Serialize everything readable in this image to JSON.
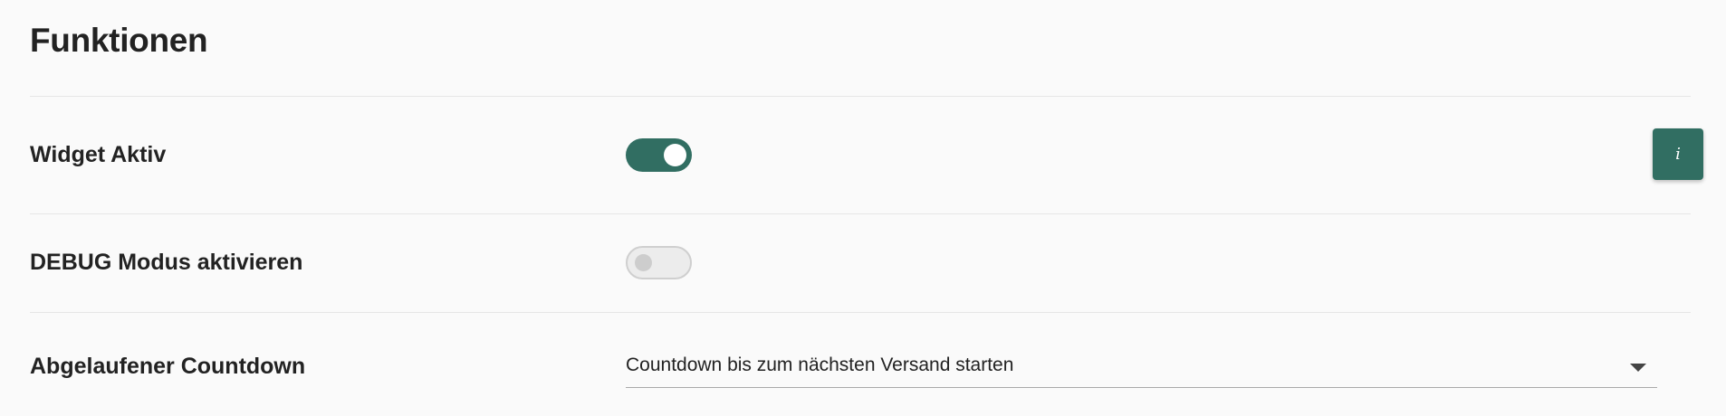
{
  "section": {
    "title": "Funktionen"
  },
  "settings": [
    {
      "label": "Widget Aktiv",
      "control": "toggle",
      "state": "on"
    },
    {
      "label": "DEBUG Modus aktivieren",
      "control": "toggle",
      "state": "off"
    },
    {
      "label": "Abgelaufener Countdown",
      "control": "select",
      "value": "Countdown bis zum nächsten Versand starten"
    }
  ],
  "info_button": {
    "label": "i",
    "icon": "info-icon"
  },
  "colors": {
    "accent": "#316e62",
    "background": "#fafafa",
    "divider": "#e6e6e6",
    "toggle_off_track": "#ececec",
    "toggle_off_knob": "#cdcdcd"
  }
}
